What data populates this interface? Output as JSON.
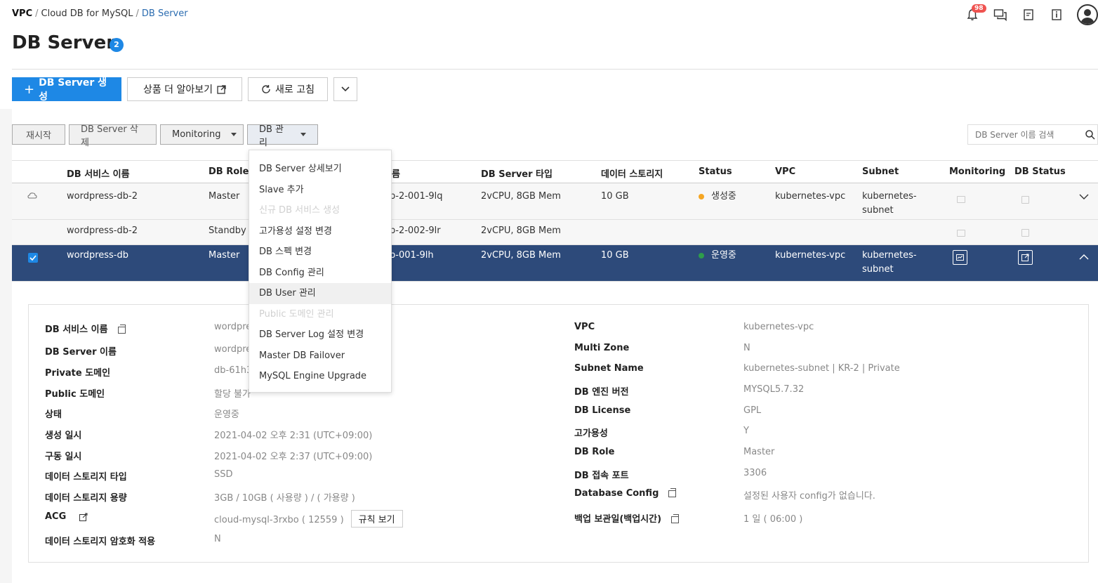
{
  "breadcrumb": {
    "vpc": "VPC",
    "sep1": "/",
    "cloud_db": "Cloud DB for MySQL",
    "sep2": "/",
    "db_server": "DB Server"
  },
  "page": {
    "title": "DB Server",
    "count": "2"
  },
  "notifications": {
    "count": "98"
  },
  "actions": {
    "create": "DB Server 생성",
    "learn_more": "상품 더 알아보기",
    "refresh": "새로 고침"
  },
  "toolbar": {
    "restart": "재시작",
    "delete": "DB Server 삭제",
    "monitoring": "Monitoring",
    "db_manage": "DB 관리"
  },
  "search": {
    "placeholder": "DB Server 이름 검색"
  },
  "table": {
    "headers": {
      "service_name": "DB 서비스 이름",
      "role": "DB Role",
      "server_name": "름",
      "type": "DB Server 타입",
      "storage": "데이터 스토리지",
      "status": "Status",
      "vpc": "VPC",
      "subnet": "Subnet",
      "monitoring": "Monitoring",
      "db_status": "DB Status"
    },
    "rows": [
      {
        "service_name": "wordpress-db-2",
        "role": "Master",
        "server_name": "b-2-001-9lq",
        "type": "2vCPU, 8GB Mem",
        "storage": "10 GB",
        "status": "생성중",
        "vpc": "kubernetes-vpc",
        "subnet": "kubernetes-subnet"
      },
      {
        "service_name": "wordpress-db-2",
        "role": "Standby M",
        "server_name": "b-2-002-9lr",
        "type": "2vCPU, 8GB Mem",
        "storage": "",
        "status": "",
        "vpc": "",
        "subnet": ""
      },
      {
        "service_name": "wordpress-db",
        "role": "Master",
        "server_name": "b-001-9lh",
        "type": "2vCPU, 8GB Mem",
        "storage": "10 GB",
        "status": "운영중",
        "vpc": "kubernetes-vpc",
        "subnet": "kubernetes-subnet"
      }
    ]
  },
  "detail": {
    "left": [
      {
        "label": "DB 서비스 이름",
        "value": "wordpre"
      },
      {
        "label": "DB Server 이름",
        "value": "wordpre"
      },
      {
        "label": "Private 도메인",
        "value": "db-61h3"
      },
      {
        "label": "Public 도메인",
        "value": "할당 불가"
      },
      {
        "label": "상태",
        "value": "운영중"
      },
      {
        "label": "생성 일시",
        "value": "2021-04-02 오후 2:31 (UTC+09:00)"
      },
      {
        "label": "구동 일시",
        "value": "2021-04-02 오후 2:37 (UTC+09:00)"
      },
      {
        "label": "데이터 스토리지 타입",
        "value": "SSD"
      },
      {
        "label": "데이터 스토리지 용량",
        "value": "3GB / 10GB ( 사용량 ) / ( 가용량 )"
      },
      {
        "label": "ACG",
        "value": "cloud-mysql-3rxbo ( 12559 )"
      },
      {
        "label": "데이터 스토리지 암호화 적용",
        "value": "N"
      }
    ],
    "acg_rule_button": "규칙 보기",
    "right": [
      {
        "label": "VPC",
        "value": "kubernetes-vpc"
      },
      {
        "label": "Multi Zone",
        "value": "N"
      },
      {
        "label": "Subnet Name",
        "value": "kubernetes-subnet | KR-2 | Private"
      },
      {
        "label": "DB 엔진 버전",
        "value": "MYSQL5.7.32"
      },
      {
        "label": "DB License",
        "value": "GPL"
      },
      {
        "label": "고가용성",
        "value": "Y"
      },
      {
        "label": "DB Role",
        "value": "Master"
      },
      {
        "label": "DB 접속 포트",
        "value": "3306"
      },
      {
        "label": "Database Config",
        "value": "설정된 사용자 config가 없습니다."
      },
      {
        "label": "백업 보관일(백업시간)",
        "value": "1 일 ( 06:00 )"
      }
    ]
  },
  "dropdown": {
    "items": [
      {
        "label": "DB Server 상세보기",
        "disabled": false
      },
      {
        "label": "Slave 추가",
        "disabled": false
      },
      {
        "label": "신규 DB 서비스 생성",
        "disabled": true
      },
      {
        "label": "고가용성 설정 변경",
        "disabled": false
      },
      {
        "label": "DB 스펙 변경",
        "disabled": false
      },
      {
        "label": "DB Config 관리",
        "disabled": false
      },
      {
        "label": "DB User 관리",
        "disabled": false
      },
      {
        "label": "Public 도메인 관리",
        "disabled": true
      },
      {
        "label": "DB Server Log 설정 변경",
        "disabled": false
      },
      {
        "label": "Master DB Failover",
        "disabled": false
      },
      {
        "label": "MySQL Engine Upgrade",
        "disabled": false
      }
    ]
  },
  "colors": {
    "primary": "#1e88e5",
    "selected_row": "#2d4a7a",
    "status_creating": "#f5a623",
    "status_running": "#2e9d4b"
  }
}
